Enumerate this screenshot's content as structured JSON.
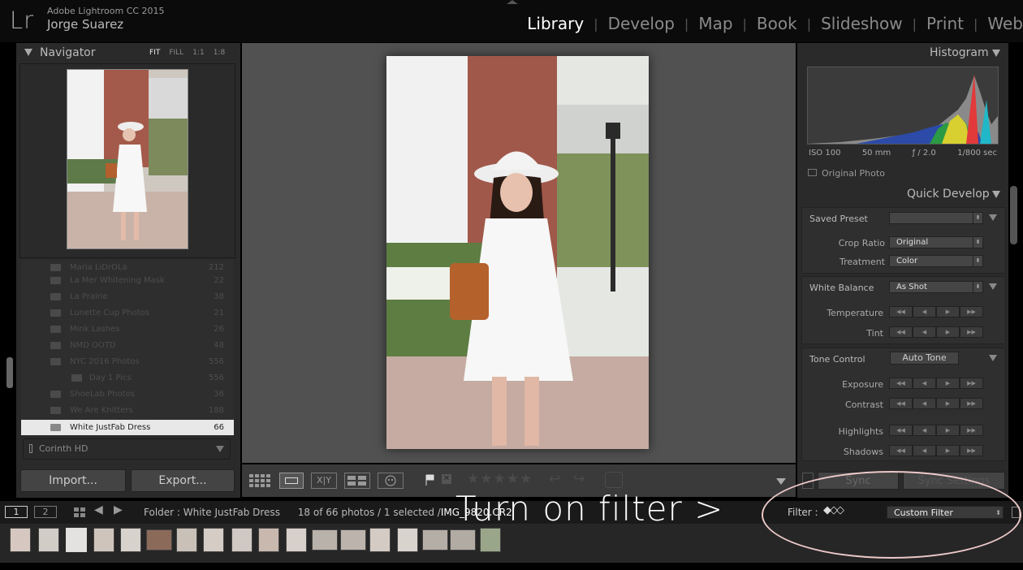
{
  "app": {
    "logo": "Lr",
    "name": "Adobe Lightroom CC 2015",
    "user": "Jorge Suarez"
  },
  "modules": [
    {
      "label": "Library",
      "active": true
    },
    {
      "label": "Develop"
    },
    {
      "label": "Map"
    },
    {
      "label": "Book"
    },
    {
      "label": "Slideshow"
    },
    {
      "label": "Print"
    },
    {
      "label": "Web"
    }
  ],
  "navigator": {
    "title": "Navigator",
    "zoom": [
      "FIT",
      "FILL",
      "1:1",
      "1:8"
    ]
  },
  "folders": [
    {
      "name": "Maria LiDrOLa",
      "count": "212"
    },
    {
      "name": "La Mer Whitening Mask",
      "count": "22"
    },
    {
      "name": "La Prairie",
      "count": "38"
    },
    {
      "name": "Lunette Cup Photos",
      "count": "21"
    },
    {
      "name": "Mink Lashes",
      "count": "26"
    },
    {
      "name": "NMD OOTD",
      "count": "48"
    },
    {
      "name": "NYC 2016 Photos",
      "count": "556"
    },
    {
      "name": "Day 1 Pics",
      "count": "556"
    },
    {
      "name": "ShoeLab Photos",
      "count": "36"
    },
    {
      "name": "We Are Knitters",
      "count": "188"
    },
    {
      "name": "White JustFab Dress",
      "count": "66",
      "selected": true
    }
  ],
  "collection_label": "Corinth HD",
  "buttons": {
    "import": "Import...",
    "export": "Export...",
    "sync": "Sync",
    "sync_settings": "Sync Settings"
  },
  "histogram": {
    "title": "Histogram",
    "iso": "ISO 100",
    "focal": "50 mm",
    "aperture": "ƒ / 2.0",
    "shutter": "1/800 sec",
    "original_photo": "Original Photo"
  },
  "quick_develop": {
    "title": "Quick Develop",
    "saved_preset": "Saved Preset",
    "crop_ratio_label": "Crop Ratio",
    "crop_ratio": "Original",
    "treatment_label": "Treatment",
    "treatment": "Color",
    "white_balance_label": "White Balance",
    "white_balance": "As Shot",
    "temperature": "Temperature",
    "tint": "Tint",
    "tone_control": "Tone Control",
    "auto_tone": "Auto Tone",
    "exposure": "Exposure",
    "contrast": "Contrast",
    "highlights": "Highlights",
    "shadows": "Shadows"
  },
  "filmstrip": {
    "page1": "1",
    "page2": "2",
    "folder": "Folder : White JustFab Dress",
    "count": "18 of 66 photos / 1 selected /",
    "filename": "IMG_9820.CR2",
    "filter_label": "Filter :",
    "filter_value": "Custom Filter"
  },
  "overlay": {
    "text": "Turn on filter >"
  },
  "colors": {
    "accent_overlay": "#ecc8c8",
    "active_module": "#ffffff"
  }
}
